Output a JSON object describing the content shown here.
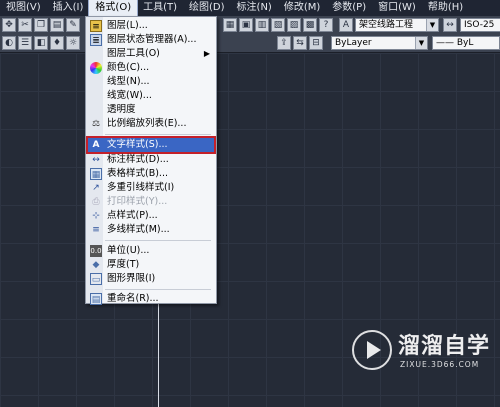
{
  "menubar": {
    "items": [
      "视图(V)",
      "插入(I)",
      "格式(O)",
      "工具(T)",
      "绘图(D)",
      "标注(N)",
      "修改(M)",
      "参数(P)",
      "窗口(W)",
      "帮助(H)"
    ],
    "active_index": 2
  },
  "toolbar": {
    "text_style_combo": "架空线路工程",
    "dim_style_combo": "ISO-25",
    "color_combo": "ByLayer",
    "linetype_combo": "—— ByL"
  },
  "format_menu": {
    "items": [
      {
        "label": "图层(L)...",
        "icon": "layers-icon"
      },
      {
        "label": "图层状态管理器(A)...",
        "icon": "layer-state-icon"
      },
      {
        "label": "图层工具(O)",
        "icon": "",
        "submenu": true
      },
      {
        "label": "颜色(C)...",
        "icon": "color-wheel-icon"
      },
      {
        "label": "线型(N)...",
        "icon": ""
      },
      {
        "label": "线宽(W)...",
        "icon": ""
      },
      {
        "label": "透明度",
        "icon": ""
      },
      {
        "label": "比例缩放列表(E)...",
        "icon": "scale-list-icon"
      },
      {
        "label": "文字样式(S)...",
        "icon": "text-style-icon",
        "highlighted": true
      },
      {
        "label": "标注样式(D)...",
        "icon": "dim-style-icon"
      },
      {
        "label": "表格样式(B)...",
        "icon": "table-style-icon"
      },
      {
        "label": "多重引线样式(I)",
        "icon": "multileader-style-icon"
      },
      {
        "label": "打印样式(Y)...",
        "icon": "plot-style-icon",
        "disabled": true
      },
      {
        "label": "点样式(P)...",
        "icon": "point-style-icon"
      },
      {
        "label": "多线样式(M)...",
        "icon": "mline-style-icon"
      },
      {
        "label": "单位(U)...",
        "icon": "units-icon"
      },
      {
        "label": "厚度(T)",
        "icon": "thickness-icon"
      },
      {
        "label": "图形界限(I)",
        "icon": "limits-icon"
      },
      {
        "label": "重命名(R)...",
        "icon": "rename-icon"
      }
    ]
  },
  "watermark": {
    "title": "溜溜自学",
    "subtitle": "ZIXUE.3D66.COM"
  },
  "colors": {
    "canvas": "#252b37",
    "menu_highlight": "#3a66c4",
    "highlight_frame": "#c4202a"
  }
}
